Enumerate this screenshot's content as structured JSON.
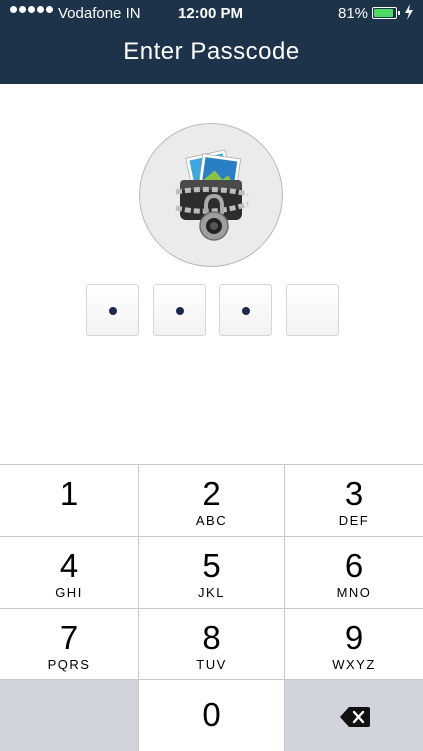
{
  "status_bar": {
    "carrier": "Vodafone IN",
    "time": "12:00 PM",
    "battery_percent": "81%",
    "battery_level": 0.81,
    "signal_strength": 5
  },
  "header": {
    "title": "Enter Passcode"
  },
  "passcode": {
    "length": 4,
    "filled": 3
  },
  "keypad": {
    "keys": [
      {
        "digit": "1",
        "letters": ""
      },
      {
        "digit": "2",
        "letters": "ABC"
      },
      {
        "digit": "3",
        "letters": "DEF"
      },
      {
        "digit": "4",
        "letters": "GHI"
      },
      {
        "digit": "5",
        "letters": "JKL"
      },
      {
        "digit": "6",
        "letters": "MNO"
      },
      {
        "digit": "7",
        "letters": "PQRS"
      },
      {
        "digit": "8",
        "letters": "TUV"
      },
      {
        "digit": "9",
        "letters": "WXYZ"
      },
      {
        "digit": "0",
        "letters": ""
      }
    ],
    "backspace_icon": "backspace-icon"
  },
  "colors": {
    "header_bg": "#1c3349",
    "pin_dot": "#1c2a4e",
    "battery_fill": "#4cd964",
    "key_border": "#c8c8cc",
    "blank_key_bg": "#d1d5db"
  }
}
